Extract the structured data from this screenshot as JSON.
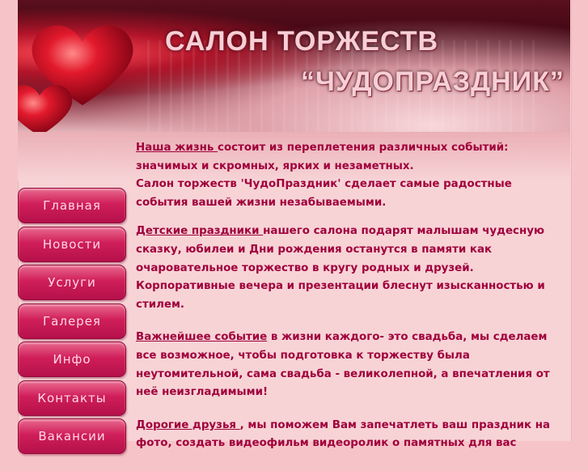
{
  "header": {
    "title_line1": "САЛОН ТОРЖЕСТВ",
    "title_line2": "“ЧУДОПРАЗДНИК”"
  },
  "nav": {
    "items": [
      {
        "label": "Главная"
      },
      {
        "label": "Новости"
      },
      {
        "label": "Услуги"
      },
      {
        "label": "Галерея"
      },
      {
        "label": "Инфо"
      },
      {
        "label": "Контакты"
      },
      {
        "label": "Вакансии"
      }
    ]
  },
  "content": {
    "p1": {
      "link": "Наша жизнь  ",
      "text": " состоит из переплетения различных событий: значимых и скромных, ярких и незаметных."
    },
    "p1b": "Салон торжеств 'ЧудоПраздник' сделает самые радостные события вашей жизни незабываемыми.",
    "p2": {
      "link": "Детские праздники ",
      "text": " нашего салона подарят малышам чудесную сказку, юбилеи и Дни рождения               останутся в памяти как очаровательное торжество в кругу родных и друзей. Корпоративные вечера и презентации блеснут изысканностью и стилем."
    },
    "p3": {
      "link": "Важнейшее событие",
      "text": " в жизни каждого- это свадьба, мы сделаем все возможное, чтобы подготовка   к торжеству была неутомительной, сама свадьба - великолепной, а впечатления от неё неизгладимыми!"
    },
    "p4": {
      "link": "Дорогие друзья ",
      "text": ", мы поможем Вам запечатлеть ваш праздник на фото, создать видеофильм      видеоролик о памятных для вас"
    }
  },
  "colors": {
    "accent": "#a0003c",
    "nav_button": "#d01f5a",
    "background": "#f7d3d6"
  },
  "icons": [
    "heart-icon"
  ]
}
